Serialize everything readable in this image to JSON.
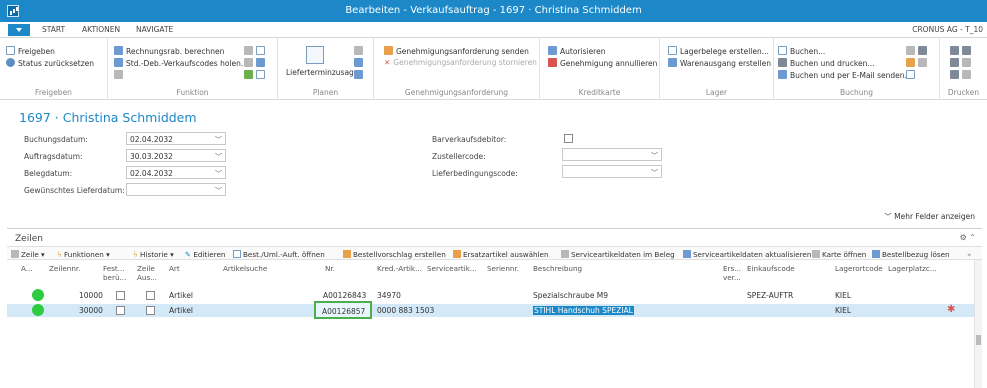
{
  "window": {
    "title": "Bearbeiten - Verkaufsauftrag - 1697 · Christina Schmiddem"
  },
  "tabs": {
    "items": [
      "START",
      "AKTIONEN",
      "NAVIGATE"
    ],
    "company": "CRONUS AG - T_10"
  },
  "ribbon": {
    "freigeben": {
      "items": [
        "Freigeben",
        "Status zurücksetzen"
      ],
      "group": "Freigeben"
    },
    "funktion": {
      "items": [
        "Rechnungsrab. berechnen",
        "Std.-Deb.-Verkaufscodes holen..."
      ],
      "group": "Funktion"
    },
    "planen": {
      "items": [
        "Lieferterminzusagen"
      ],
      "group": "Planen"
    },
    "genehmigung": {
      "items": [
        "Genehmigungsanforderung senden",
        "Genehmigungsanforderung stornieren"
      ],
      "group": "Genehmigungsanforderung"
    },
    "kreditkarte": {
      "items": [
        "Autorisieren",
        "Genehmigung annullieren"
      ],
      "group": "Kreditkarte"
    },
    "lager": {
      "items": [
        "Lagerbelege erstellen...",
        "Warenausgang erstellen"
      ],
      "group": "Lager"
    },
    "buchung": {
      "items": [
        "Buchen...",
        "Buchen und drucken...",
        "Buchen und per E-Mail senden..."
      ],
      "group": "Buchung"
    },
    "drucken": {
      "group": "Drucken"
    }
  },
  "header": {
    "title": "1697 · Christina Schmiddem",
    "fields_left": [
      {
        "label": "Buchungsdatum:",
        "value": "02.04.2032"
      },
      {
        "label": "Auftragsdatum:",
        "value": "30.03.2032"
      },
      {
        "label": "Belegdatum:",
        "value": "02.04.2032"
      },
      {
        "label": "Gewünschtes Lieferdatum:",
        "value": ""
      }
    ],
    "fields_right": [
      {
        "label": "Barverkaufsdebitor:",
        "value": ""
      },
      {
        "label": "Zustellercode:",
        "value": ""
      },
      {
        "label": "Lieferbedingungscode:",
        "value": ""
      }
    ],
    "more_fields": "Mehr Felder anzeigen"
  },
  "lines": {
    "title": "Zeilen",
    "toolbar": [
      "Zeile",
      "Funktionen",
      "Historie",
      "Editieren",
      "Best./Uml.-Auft. öffnen",
      "Bestellvorschlag erstellen",
      "Ersatzartikel auswählen",
      "Serviceartikeldaten im Beleg",
      "Serviceartikeldaten aktualisieren",
      "Karte öffnen",
      "Bestellbezug lösen"
    ],
    "columns": {
      "a": "A...",
      "zeilennr": "Zeilennr.",
      "fest": "Fest...",
      "fest2": "berü...",
      "zeile": "Zeile",
      "zeile2": "Aus...",
      "art": "Art",
      "artikelsuche": "Artikelsuche",
      "nr": "Nr.",
      "kred": "Kred.-Artik...",
      "service": "Serviceartik...",
      "serien": "Seriennr.",
      "beschreibung": "Beschreibung",
      "ers": "Ers...",
      "ers2": "ver...",
      "einkaufscode": "Einkaufscode",
      "lagerort": "Lagerortcode",
      "lagerplatz": "Lagerplatzc..."
    },
    "rows": [
      {
        "zeilennr": "10000",
        "art": "Artikel",
        "nr": "A00126843",
        "kred": "34970",
        "beschreibung": "Spezialschraube M9",
        "einkaufscode": "SPEZ-AUFTR",
        "lagerort": "KIEL"
      },
      {
        "zeilennr": "30000",
        "art": "Artikel",
        "nr": "A00126857",
        "kred": "0000 883 1503",
        "beschreibung": "STIHL Handschuh SPEZIAL",
        "einkaufscode": "",
        "lagerort": "KIEL"
      }
    ]
  },
  "colors": {
    "accent": "#1d88c7",
    "status_green": "#2ecc40",
    "selected_row": "#d3e9f8"
  }
}
